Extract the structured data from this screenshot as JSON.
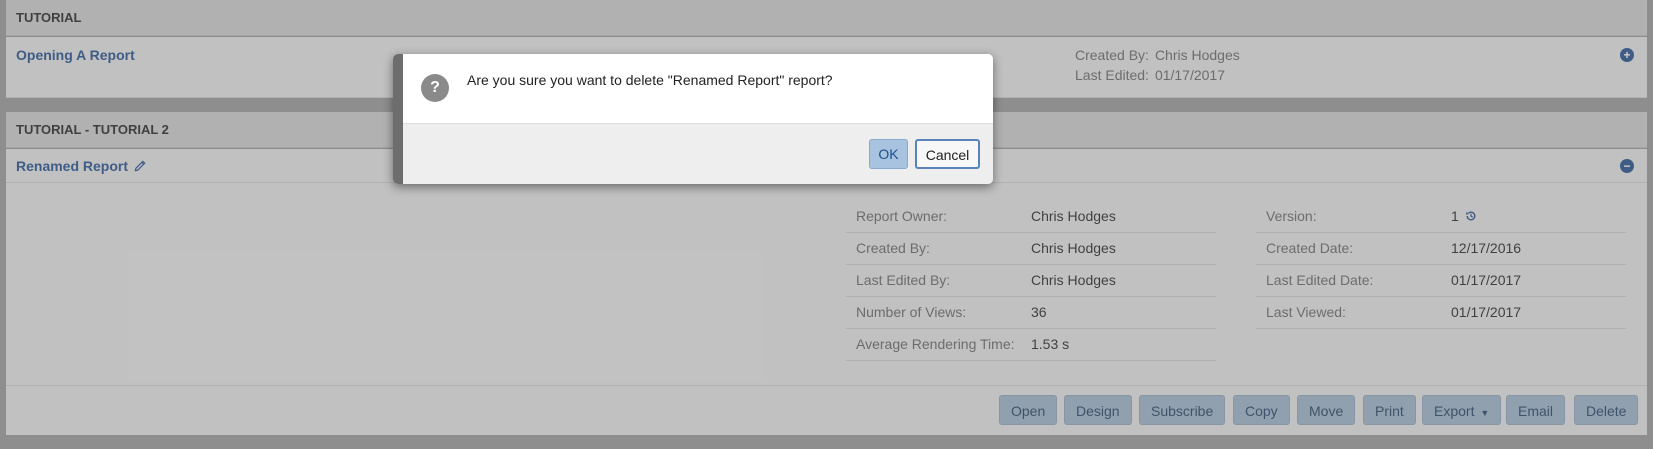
{
  "sections": [
    {
      "title": "TUTORIAL"
    },
    {
      "title": "TUTORIAL - TUTORIAL 2"
    }
  ],
  "report1": {
    "name": "Opening A Report",
    "created_by_label": "Created By:",
    "created_by": "Chris Hodges",
    "last_edited_label": "Last Edited:",
    "last_edited": "01/17/2017",
    "expand_icon": "plus-circle-icon"
  },
  "report2": {
    "name": "Renamed Report",
    "edit_icon": "pencil-icon",
    "collapse_icon": "minus-circle-icon"
  },
  "details_left": [
    {
      "label": "Report Owner:",
      "value": "Chris Hodges"
    },
    {
      "label": "Created By:",
      "value": "Chris Hodges"
    },
    {
      "label": "Last Edited By:",
      "value": "Chris Hodges"
    },
    {
      "label": "Number of Views:",
      "value": "36"
    },
    {
      "label": "Average Rendering Time:",
      "value": "1.53 s"
    }
  ],
  "details_right": [
    {
      "label": "Version:",
      "value": "1"
    },
    {
      "label": "Created Date:",
      "value": "12/17/2016"
    },
    {
      "label": "Last Edited Date:",
      "value": "01/17/2017"
    },
    {
      "label": "Last Viewed:",
      "value": "01/17/2017"
    }
  ],
  "toolbar": {
    "open": "Open",
    "design": "Design",
    "subscribe": "Subscribe",
    "copy": "Copy",
    "move": "Move",
    "print": "Print",
    "export": "Export",
    "email": "Email",
    "delete": "Delete"
  },
  "dialog": {
    "message": "Are you sure you want to delete \"Renamed Report\" report?",
    "ok": "OK",
    "cancel": "Cancel",
    "icon": "question-icon"
  },
  "colors": {
    "link": "#1f4e8c",
    "button": "#9fb6cc"
  }
}
